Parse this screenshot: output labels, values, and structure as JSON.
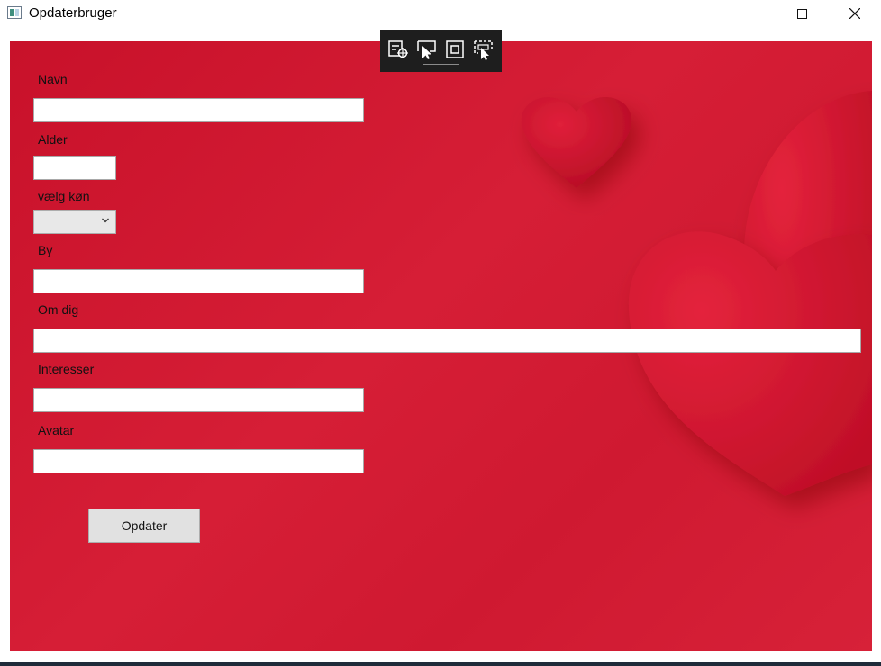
{
  "window": {
    "title": "Opdaterbruger",
    "controls": [
      "minimize-icon",
      "maximize-icon",
      "close-icon"
    ]
  },
  "debug_toolbar": {
    "icons": [
      "select-element-icon",
      "pointer-select-icon",
      "layout-adorner-icon",
      "track-focus-icon"
    ]
  },
  "form": {
    "navn_label": "Navn",
    "navn_value": "",
    "alder_label": "Alder",
    "alder_value": "",
    "gender_label": "vælg køn",
    "gender_value": "",
    "by_label": "By",
    "by_value": "",
    "om_dig_label": "Om dig",
    "om_dig_value": "",
    "interesser_label": "Interesser",
    "interesser_value": "",
    "avatar_label": "Avatar",
    "avatar_value": "",
    "submit_label": "Opdater"
  },
  "colors": {
    "background": "#d01c33",
    "heart": "#d8112e"
  }
}
